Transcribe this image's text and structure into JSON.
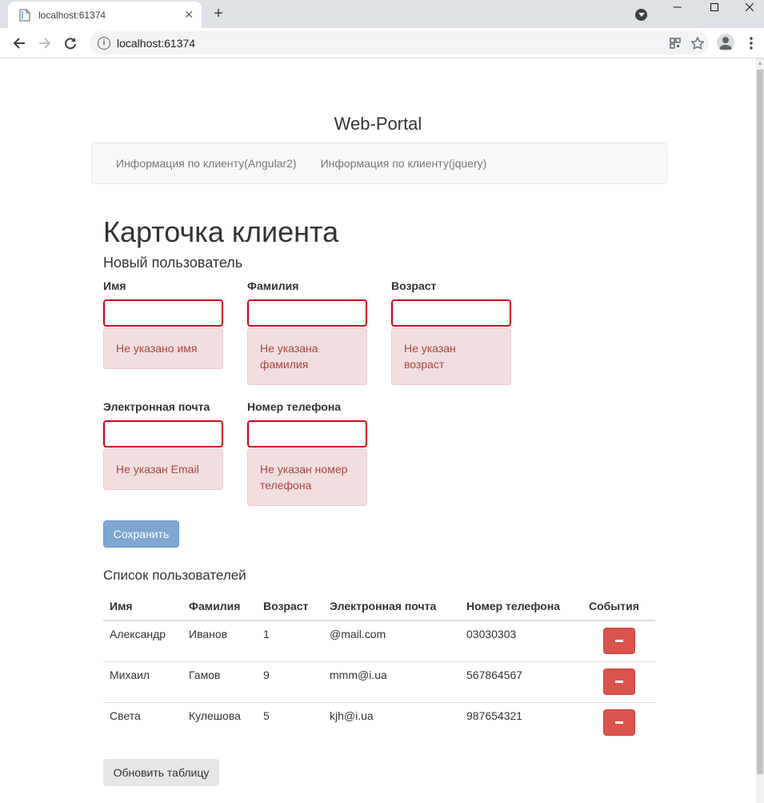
{
  "browser": {
    "tab_title": "localhost:61374",
    "url": "localhost:61374",
    "new_tab_label": "+",
    "tab_close_label": "✕"
  },
  "page": {
    "site_title": "Web-Portal",
    "nav": [
      {
        "label": "Информация по клиенту(Angular2)"
      },
      {
        "label": "Информация по клиенту(jquery)"
      }
    ],
    "heading": "Карточка клиента",
    "subheading": "Новый пользователь"
  },
  "form": {
    "first_name": {
      "label": "Имя",
      "value": "",
      "error": "Не указано имя"
    },
    "last_name": {
      "label": "Фамилия",
      "value": "",
      "error": "Не указана фамилия"
    },
    "age": {
      "label": "Возраст",
      "value": "",
      "error": "Не указан возраст"
    },
    "email": {
      "label": "Электронная почта",
      "value": "",
      "error": "Не указан Email"
    },
    "phone": {
      "label": "Номер телефона",
      "value": "",
      "error": "Не указан номер телефона"
    },
    "save_label": "Сохранить"
  },
  "users": {
    "heading": "Список пользователей",
    "columns": [
      "Имя",
      "Фамилия",
      "Возраст",
      "Электронная почта",
      "Номер телефона",
      "События"
    ],
    "rows": [
      [
        "Александр",
        "Иванов",
        "1",
        "@mail.com",
        "03030303"
      ],
      [
        "Михаил",
        "Гамов",
        "9",
        "mmm@i.ua",
        "567864567"
      ],
      [
        "Света",
        "Кулешова",
        "5",
        "kjh@i.ua",
        "987654321"
      ]
    ],
    "refresh_label": "Обновить таблицу"
  },
  "colors": {
    "error_border": "#d9001b",
    "error_bg": "#f2dede",
    "error_text": "#a94442",
    "primary_btn": "#7fa7d1",
    "danger_btn": "#d9534f"
  },
  "icons": {
    "delete_button_icon": "minus-icon"
  }
}
